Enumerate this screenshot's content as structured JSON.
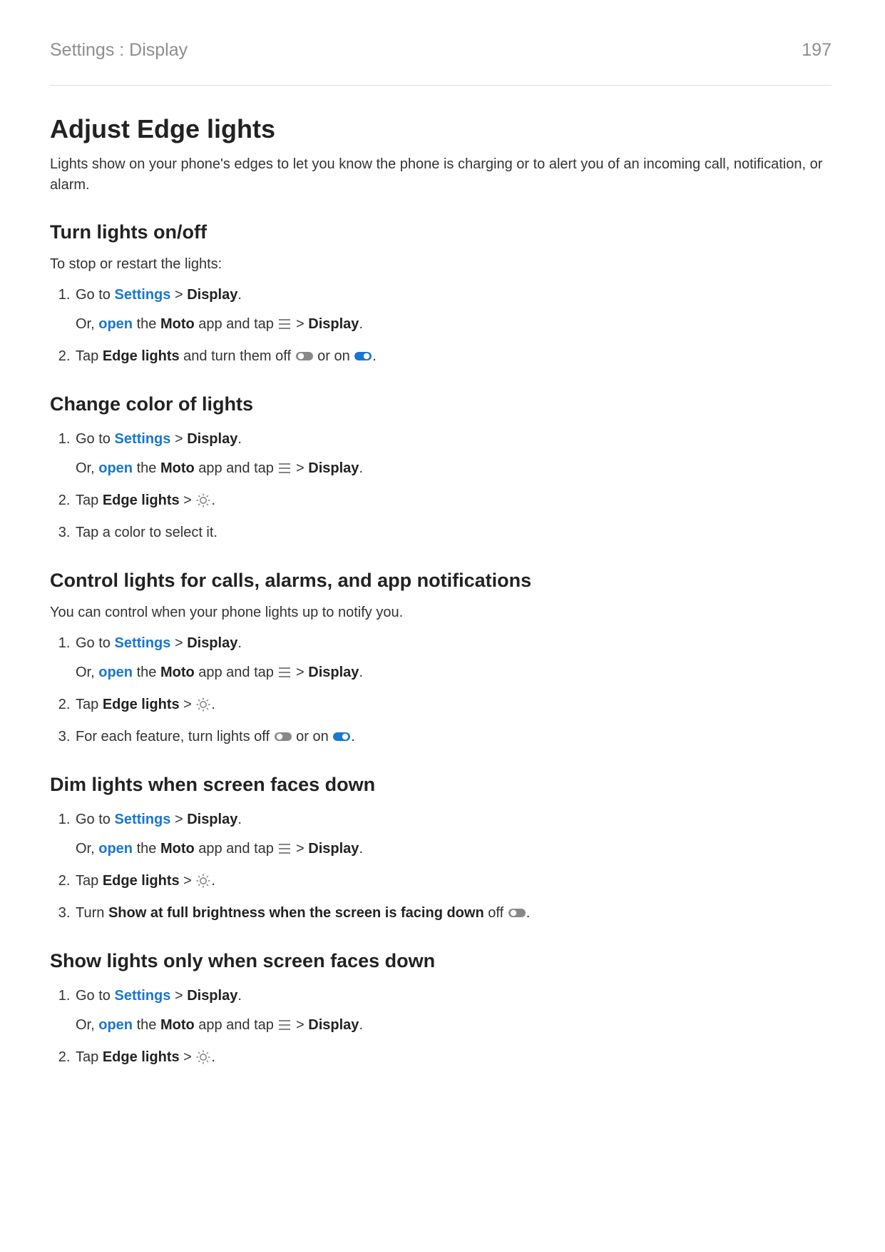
{
  "header": {
    "breadcrumb": "Settings : Display",
    "page_number": "197"
  },
  "title": "Adjust Edge lights",
  "intro": "Lights show on your phone's edges to let you know the phone is charging or to alert you of an incoming call, notification, or alarm.",
  "common": {
    "goto_prefix": "Go to ",
    "settings_link": "Settings",
    "gt": " > ",
    "display_bold": "Display",
    "period": ".",
    "or_prefix": "Or, ",
    "open_link": "open",
    "or_mid1": " the ",
    "moto_bold": "Moto",
    "or_mid2": " app and tap ",
    "or_after_menu": " > ",
    "tap_prefix": "Tap ",
    "edge_lights_bold": "Edge lights",
    "edge_lights_sep": " > "
  },
  "s1": {
    "heading": "Turn lights on/off",
    "desc": "To stop or restart the lights:",
    "step2_a": "Tap ",
    "step2_b": "Edge lights",
    "step2_c": " and turn them off ",
    "step2_d": " or on ",
    "step2_e": "."
  },
  "s2": {
    "heading": "Change color of lights",
    "step3": "Tap a color to select it."
  },
  "s3": {
    "heading": "Control lights for calls, alarms, and app notifications",
    "desc": "You can control when your phone lights up to notify you.",
    "step3_a": "For each feature, turn lights off ",
    "step3_b": " or on ",
    "step3_c": "."
  },
  "s4": {
    "heading": "Dim lights when screen faces down",
    "step3_a": "Turn ",
    "step3_b": "Show at full brightness when the screen is facing down",
    "step3_c": " off ",
    "step3_d": "."
  },
  "s5": {
    "heading": "Show lights only when screen faces down"
  }
}
